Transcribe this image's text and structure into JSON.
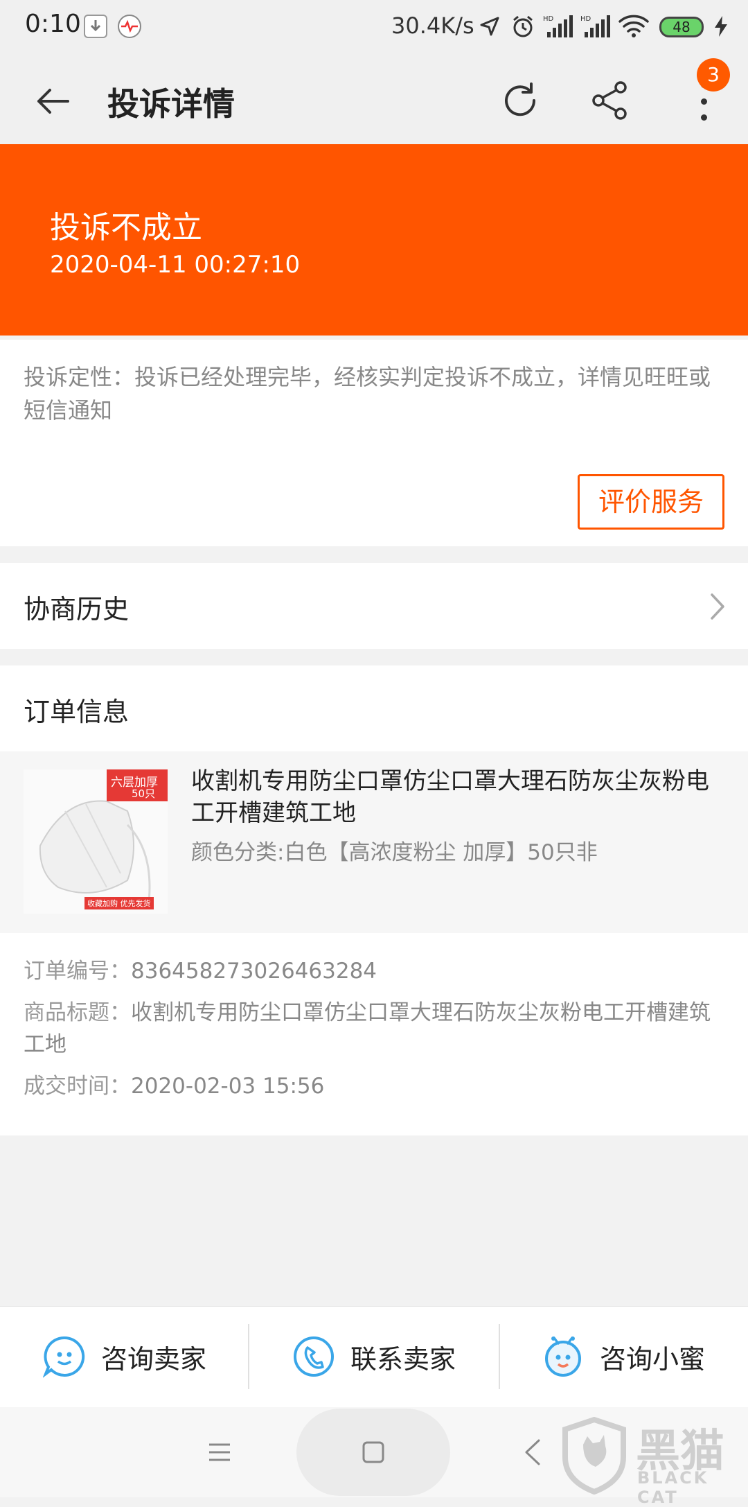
{
  "status_bar": {
    "time": "0:10",
    "net_speed": "30.4K/s",
    "battery": "48"
  },
  "header": {
    "title": "投诉详情",
    "badge_count": "3"
  },
  "banner": {
    "status": "投诉不成立",
    "time": "2020-04-11 00:27:10",
    "color": "#ff5500"
  },
  "verdict": {
    "text": "投诉定性：投诉已经处理完毕，经核实判定投诉不成立，详情见旺旺或短信通知",
    "rate_button": "评价服务"
  },
  "negotiation": {
    "label": "协商历史"
  },
  "order": {
    "section_title": "订单信息",
    "product": {
      "title": "收割机专用防尘口罩仿尘口罩大理石防灰尘灰粉电工开槽建筑工地",
      "sku": "颜色分类:白色【高浓度粉尘 加厚】50只非",
      "thumb_tag": "六层加厚",
      "thumb_count": "50只",
      "thumb_footer": "收藏加购 优先发货"
    },
    "number_label": "订单编号：",
    "number": "836458273026463284",
    "title_label": "商品标题：",
    "title": "收割机专用防尘口罩仿尘口罩大理石防灰尘灰粉电工开槽建筑工地",
    "time_label": "成交时间：",
    "time": "2020-02-03 15:56"
  },
  "actions": {
    "consult_seller": "咨询卖家",
    "contact_seller": "联系卖家",
    "consult_assistant": "咨询小蜜"
  },
  "watermark": {
    "text": "黑猫",
    "sub": "BLACK CAT"
  }
}
